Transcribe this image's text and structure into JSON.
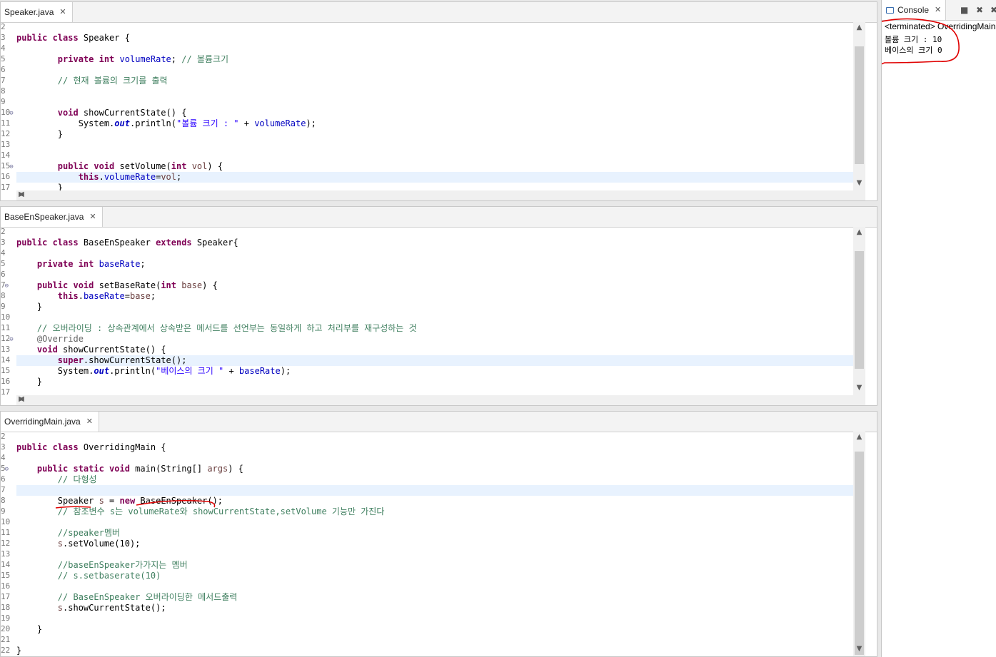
{
  "editors": [
    {
      "tab": "Speaker.java",
      "lines": [
        {
          "n": "2",
          "h": ""
        },
        {
          "n": "3",
          "h": "<span class='kw'>public class</span> Speaker {"
        },
        {
          "n": "4",
          "h": ""
        },
        {
          "n": "5",
          "h": "        <span class='kw'>private int</span> <span class='fld'>volumeRate</span>; <span class='cmt'>// 볼륨크기</span>"
        },
        {
          "n": "6",
          "h": ""
        },
        {
          "n": "7",
          "h": "        <span class='cmt'>// 현재 볼륨의 크기를 출력</span>"
        },
        {
          "n": "8",
          "h": ""
        },
        {
          "n": "9",
          "h": ""
        },
        {
          "n": "10",
          "fold": true,
          "h": "        <span class='kw'>void</span> showCurrentState() {"
        },
        {
          "n": "11",
          "h": "            System.<span class='st'>out</span>.println(<span class='str'>\"볼륨 크기 : \"</span> + <span class='fld'>volumeRate</span>);"
        },
        {
          "n": "12",
          "h": "        }"
        },
        {
          "n": "13",
          "h": ""
        },
        {
          "n": "14",
          "h": ""
        },
        {
          "n": "15",
          "fold": true,
          "h": "        <span class='kw'>public void</span> setVolume(<span class='kw'>int</span> <span class='prm'>vol</span>) {"
        },
        {
          "n": "16",
          "hl": true,
          "h": "            <span class='kw'>this</span>.<span class='fld'>volumeRate</span>=<span class='prm'>vol</span>;"
        },
        {
          "n": "17",
          "h": "        }"
        }
      ]
    },
    {
      "tab": "BaseEnSpeaker.java",
      "lines": [
        {
          "n": "2",
          "h": ""
        },
        {
          "n": "3",
          "h": "<span class='kw'>public class</span> BaseEnSpeaker <span class='kw'>extends</span> Speaker{"
        },
        {
          "n": "4",
          "h": ""
        },
        {
          "n": "5",
          "h": "    <span class='kw'>private int</span> <span class='fld'>baseRate</span>;"
        },
        {
          "n": "6",
          "h": ""
        },
        {
          "n": "7",
          "fold": true,
          "h": "    <span class='kw'>public void</span> setBaseRate(<span class='kw'>int</span> <span class='prm'>base</span>) {"
        },
        {
          "n": "8",
          "h": "        <span class='kw'>this</span>.<span class='fld'>baseRate</span>=<span class='prm'>base</span>;"
        },
        {
          "n": "9",
          "h": "    }"
        },
        {
          "n": "10",
          "h": ""
        },
        {
          "n": "11",
          "h": "    <span class='cmt'>// 오버라이딩 : 상속관계에서 상속받은 메서드를 선언부는 동일하게 하고 처리부를 재구성하는 것</span>"
        },
        {
          "n": "12",
          "fold": true,
          "h": "    <span class='ann'>@Override</span>"
        },
        {
          "n": "13",
          "h": "    <span class='kw'>void</span> showCurrentState() {"
        },
        {
          "n": "14",
          "hl": true,
          "h": "        <span class='kw'>super</span>.showCurrentState();"
        },
        {
          "n": "15",
          "h": "        System.<span class='st'>out</span>.println(<span class='str'>\"베이스의 크기 \"</span> + <span class='fld'>baseRate</span>);"
        },
        {
          "n": "16",
          "h": "    }"
        },
        {
          "n": "17",
          "h": ""
        }
      ]
    },
    {
      "tab": "OverridingMain.java",
      "lines": [
        {
          "n": "2",
          "h": ""
        },
        {
          "n": "3",
          "h": "<span class='kw'>public class</span> OverridingMain {"
        },
        {
          "n": "4",
          "h": ""
        },
        {
          "n": "5",
          "fold": true,
          "h": "    <span class='kw'>public static void</span> main(String[] <span class='prm'>args</span>) {"
        },
        {
          "n": "6",
          "h": "        <span class='cmt'>// 다형성</span>"
        },
        {
          "n": "7",
          "hl": true,
          "h": ""
        },
        {
          "n": "8",
          "h": "        Speaker <span class='prm'>s</span> = <span class='kw'>new</span> BaseEnSpeaker();"
        },
        {
          "n": "9",
          "h": "        <span class='cmt'>// 참조변수 s는 volumeRate와 showCurrentState,setVolume 기능만 가진다</span>"
        },
        {
          "n": "10",
          "h": ""
        },
        {
          "n": "11",
          "h": "        <span class='cmt'>//speaker멤버</span>"
        },
        {
          "n": "12",
          "h": "        <span class='prm'>s</span>.setVolume(10);"
        },
        {
          "n": "13",
          "h": ""
        },
        {
          "n": "14",
          "h": "        <span class='cmt'>//baseEnSpeaker가가지는 멤버</span>"
        },
        {
          "n": "15",
          "h": "        <span class='cmt'>// s.setbaserate(10)</span>"
        },
        {
          "n": "16",
          "h": ""
        },
        {
          "n": "17",
          "h": "        <span class='cmt'>// BaseEnSpeaker 오버라이딩한 메서드출력</span>"
        },
        {
          "n": "18",
          "h": "        <span class='prm'>s</span>.showCurrentState();"
        },
        {
          "n": "19",
          "h": ""
        },
        {
          "n": "20",
          "h": "    }"
        },
        {
          "n": "21",
          "h": ""
        },
        {
          "n": "22",
          "h": "}"
        }
      ]
    }
  ],
  "console": {
    "tab": "Console",
    "terminated": "<terminated> OverridingMain",
    "output": [
      "볼륨 크기 : 10",
      "베이스의 크기 0"
    ]
  },
  "colors": {
    "keyword": "#7f0055",
    "field": "#0000c0",
    "string": "#2a00ff",
    "comment": "#3f7f5f",
    "annotation_mark": "#e00000"
  }
}
